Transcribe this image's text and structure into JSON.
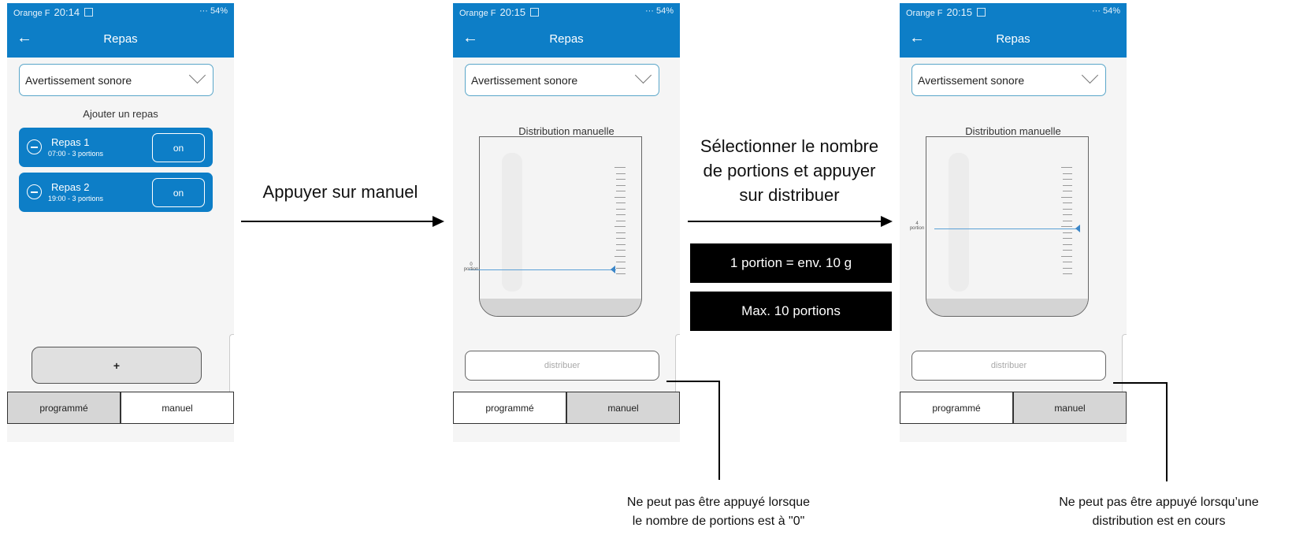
{
  "status": {
    "carrier": "Orange F",
    "times": [
      "20:14",
      "20:15",
      "20:15"
    ],
    "right": "··· 54%"
  },
  "appbar": {
    "title": "Repas",
    "back_icon": "arrow-left-icon"
  },
  "sound_select": {
    "label": "Avertissement sonore",
    "icon": "chevron-down-icon"
  },
  "screen1": {
    "add_title": "Ajouter un repas",
    "meals": [
      {
        "name": "Repas 1",
        "time": "07:00 - 3 portions",
        "toggle": "on"
      },
      {
        "name": "Repas 2",
        "time": "19:00 - 3 portions",
        "toggle": "on"
      }
    ],
    "plus_label": "+"
  },
  "tabs": {
    "scheduled": "programmé",
    "manual": "manuel"
  },
  "manual": {
    "title": "Distribution manuelle",
    "distribute_label": "distribuer",
    "screen2_level": {
      "value": "0",
      "unit": "portion"
    },
    "screen3_level": {
      "value": "4",
      "unit": "portion"
    }
  },
  "instructions": {
    "step1": "Appuyer sur manuel",
    "step2_line1": "Sélectionner le nombre",
    "step2_line2": "de portions et appuyer",
    "step2_line3": "sur distribuer",
    "box1": "1 portion = env. 10 g",
    "box2": "Max. 10 portions"
  },
  "notes": {
    "note1_line1": "Ne peut pas être appuyé lorsque",
    "note1_line2": "le nombre de portions est à \"0\"",
    "note2_line1": "Ne peut pas être appuyé lorsqu’une",
    "note2_line2": "distribution est en cours"
  },
  "colors": {
    "brand_blue": "#0d7ec7",
    "inactive_tab": "#d6d6d6"
  }
}
